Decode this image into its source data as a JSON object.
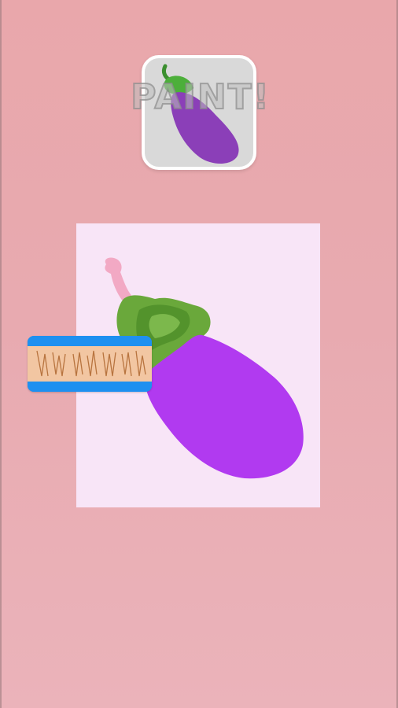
{
  "title": "PAINT!",
  "target": {
    "icon": "eggplant-icon"
  },
  "canvas": {
    "subject": "eggplant-outline"
  },
  "tool": {
    "icon": "paint-roller-icon"
  },
  "colors": {
    "background": "#e9a7ab",
    "board": "#f8e5f7",
    "eggplant_purple": "#b13af0",
    "leaf_green": "#6aa83b",
    "roller_blue": "#2196f3",
    "roller_pad": "#f2c6a2"
  }
}
